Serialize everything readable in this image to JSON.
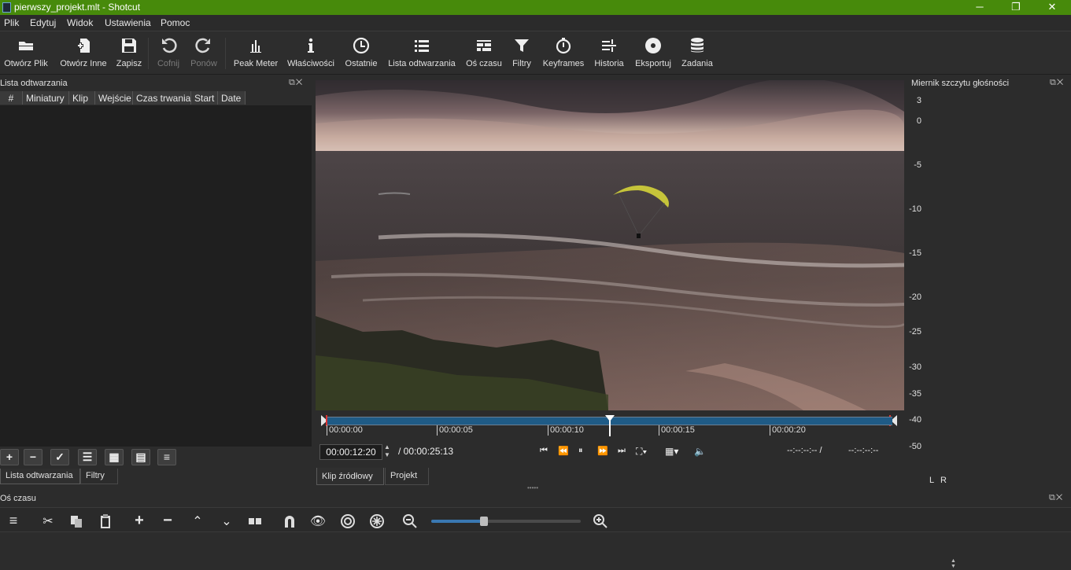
{
  "window": {
    "title": "pierwszy_projekt.mlt - Shotcut",
    "minimize": "─",
    "maximize": "❐",
    "close": "✕"
  },
  "menu": [
    "Plik",
    "Edytuj",
    "Widok",
    "Ustawienia",
    "Pomoc"
  ],
  "toolbar": {
    "open_file": "Otwórz Plik",
    "open_other": "Otwórz Inne",
    "save": "Zapisz",
    "undo": "Cofnij",
    "redo": "Ponów",
    "peak_meter": "Peak Meter",
    "properties": "Właściwości",
    "recent": "Ostatnie",
    "playlist": "Lista odtwarzania",
    "timeline": "Oś czasu",
    "filters": "Filtry",
    "keyframes": "Keyframes",
    "history": "Historia",
    "export": "Eksportuj",
    "jobs": "Zadania"
  },
  "playlist": {
    "title": "Lista odtwarzania",
    "columns": [
      "#",
      "Miniatury",
      "Klip",
      "Wejście",
      "Czas trwania",
      "Start",
      "Date"
    ],
    "tabs": [
      "Lista odtwarzania",
      "Filtry"
    ]
  },
  "player": {
    "position": "00:00:12:20",
    "duration": "/ 00:00:25:13",
    "in_point": "--:--:--:-- /",
    "out_point": "--:--:--:--",
    "ruler_labels": [
      "00:00:00",
      "00:00:05",
      "00:00:10",
      "00:00:15",
      "00:00:20"
    ],
    "tabs": [
      "Klip źródłowy",
      "Projekt"
    ]
  },
  "meter": {
    "title": "Miernik szczytu głośności",
    "scale": [
      "3",
      "0",
      "-5",
      "-10",
      "-15",
      "-20",
      "-25",
      "-30",
      "-35",
      "-40",
      "-50"
    ],
    "channels": [
      "L",
      "R"
    ]
  },
  "timeline": {
    "title": "Oś czasu",
    "zoom_level": 0.35
  },
  "colors": {
    "titlebar": "#478a0b",
    "ruler_bar": "#1f5b86",
    "background": "#2c2c2c"
  }
}
